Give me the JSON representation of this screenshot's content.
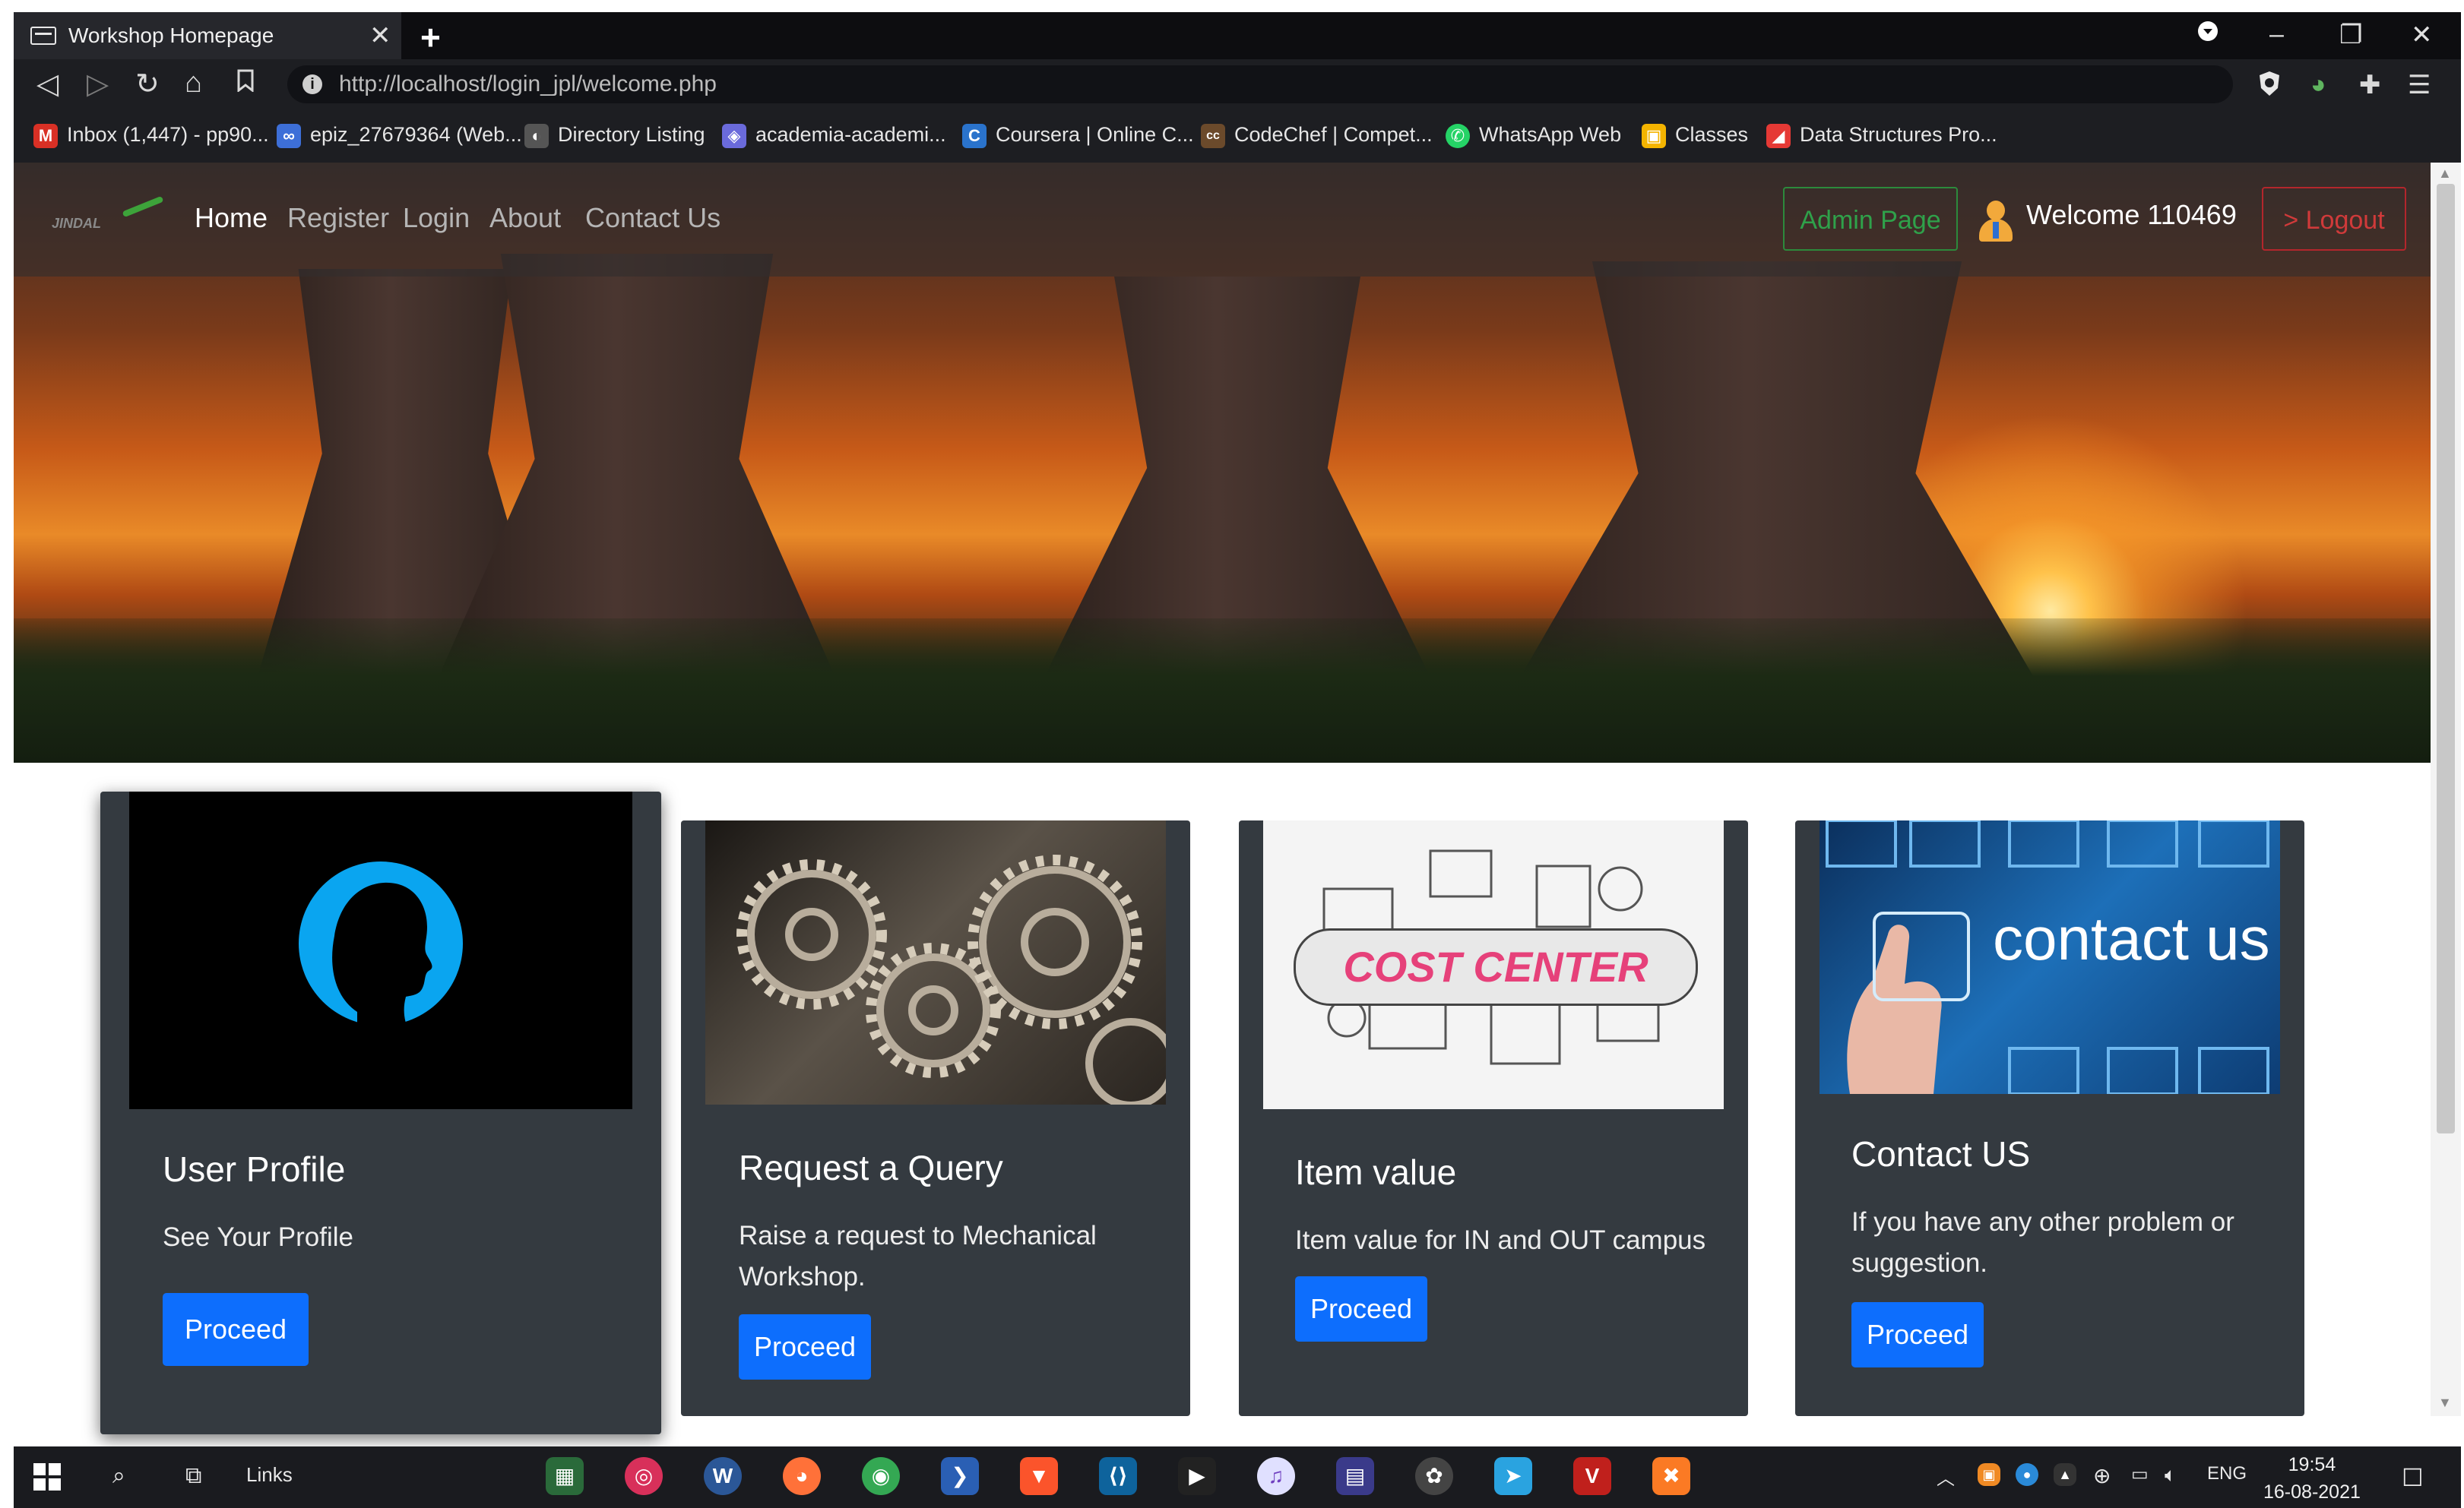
{
  "browser": {
    "tab_title": "Workshop Homepage",
    "tab_close": "✕",
    "new_tab": "+",
    "url": "http://localhost/login_jpl/welcome.php",
    "window_controls": [
      "–",
      "❐",
      "✕"
    ]
  },
  "bookmarks": [
    {
      "label": "Inbox (1,447) - pp90...",
      "icon": "gmail-icon",
      "color": "#d93025",
      "glyph": "M"
    },
    {
      "label": "epiz_27679364 (Web...",
      "icon": "infinity-icon",
      "color": "#3d6fd8",
      "glyph": "∞"
    },
    {
      "label": "Directory Listing",
      "icon": "globe-icon",
      "color": "#555555",
      "glyph": "◐"
    },
    {
      "label": "academia-academi...",
      "icon": "academia-icon",
      "color": "#6a6adb",
      "glyph": "◈"
    },
    {
      "label": "Coursera | Online C...",
      "icon": "coursera-icon",
      "color": "#2a73cc",
      "glyph": "C"
    },
    {
      "label": "CodeChef | Compet...",
      "icon": "codechef-icon",
      "color": "#6b4a2b",
      "glyph": "cc"
    },
    {
      "label": "WhatsApp Web",
      "icon": "whatsapp-icon",
      "color": "#25d366",
      "glyph": "✆"
    },
    {
      "label": "Classes",
      "icon": "classroom-icon",
      "color": "#f4b400",
      "glyph": "▣"
    },
    {
      "label": "Data Structures Pro...",
      "icon": "bookmark-app-icon",
      "color": "#e53935",
      "glyph": "◢"
    }
  ],
  "site_nav": {
    "brand": "JINDAL",
    "links": [
      "Home",
      "Register",
      "Login",
      "About",
      "Contact Us"
    ],
    "admin_button": "Admin Page",
    "welcome": "Welcome 110469",
    "logout_button": "> Logout"
  },
  "cards": [
    {
      "title": "User Profile",
      "text": "See Your Profile",
      "button": "Proceed"
    },
    {
      "title": "Request a Query",
      "text": "Raise a request to Mechanical Workshop.",
      "button": "Proceed"
    },
    {
      "title": "Item value",
      "text": "Item value for IN and OUT campus",
      "button": "Proceed",
      "image_text": "COST CENTER"
    },
    {
      "title": "Contact US",
      "text": "If you have any other problem or suggestion.",
      "button": "Proceed",
      "image_text": "contact us"
    }
  ],
  "taskbar": {
    "links_label": "Links",
    "language": "ENG",
    "time": "19:54",
    "date": "16-08-2021"
  }
}
